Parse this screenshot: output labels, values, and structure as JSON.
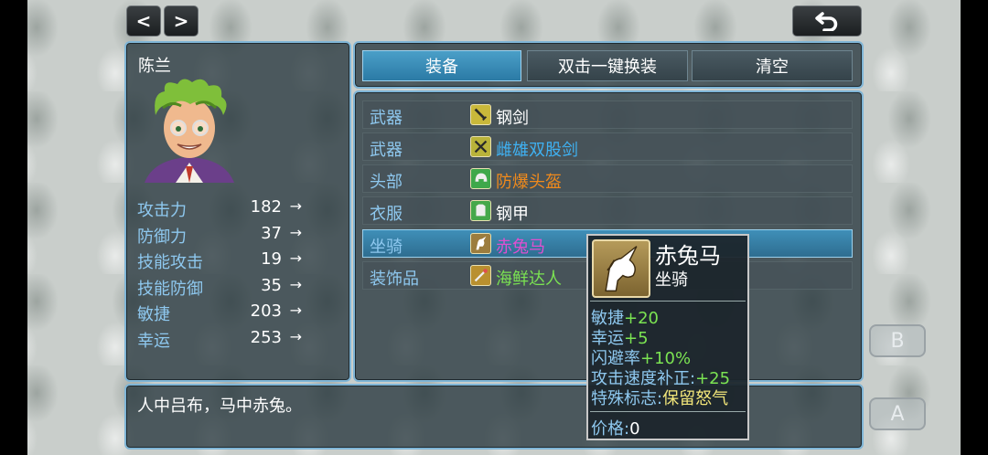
{
  "nav": {
    "prev_label": "<",
    "next_label": ">",
    "back_icon": "undo-arrow-icon"
  },
  "character": {
    "name": "陈兰",
    "stats": [
      {
        "label": "攻击力",
        "value": "182",
        "arrow": "→"
      },
      {
        "label": "防御力",
        "value": "37",
        "arrow": "→"
      },
      {
        "label": "技能攻击",
        "value": "19",
        "arrow": "→"
      },
      {
        "label": "技能防御",
        "value": "35",
        "arrow": "→"
      },
      {
        "label": "敏捷",
        "value": "203",
        "arrow": "→"
      },
      {
        "label": "幸运",
        "value": "253",
        "arrow": "→"
      }
    ]
  },
  "tabs": [
    {
      "label": "装备",
      "active": true
    },
    {
      "label": "双击一键换装",
      "active": false
    },
    {
      "label": "清空",
      "active": false
    }
  ],
  "equipment": [
    {
      "slot": "武器",
      "icon": "sword-icon",
      "name": "钢剑",
      "color": "#ffffff",
      "icon_bg": "#c9b83a"
    },
    {
      "slot": "武器",
      "icon": "crossed-swords-icon",
      "name": "雌雄双股剑",
      "color": "#3fb1f2",
      "icon_bg": "#b9b33a"
    },
    {
      "slot": "头部",
      "icon": "helmet-icon",
      "name": "防爆头盔",
      "color": "#f08a1c",
      "icon_bg": "#3fa84a"
    },
    {
      "slot": "衣服",
      "icon": "armor-icon",
      "name": "钢甲",
      "color": "#ffffff",
      "icon_bg": "#45a84a"
    },
    {
      "slot": "坐骑",
      "icon": "unicorn-icon",
      "name": "赤兔马",
      "color": "#e04fd0",
      "icon_bg": "#9c7d3e"
    },
    {
      "slot": "装饰品",
      "icon": "accessory-icon",
      "name": "海鲜达人",
      "color": "#7be352",
      "icon_bg": "#b9902f"
    }
  ],
  "tooltip": {
    "icon": "unicorn-icon",
    "title": "赤兔马",
    "subtitle": "坐骑",
    "effects": [
      {
        "label": "敏捷",
        "value": "+20",
        "value_color": "#7be352"
      },
      {
        "label": "幸运",
        "value": "+5",
        "value_color": "#7be352"
      },
      {
        "label": "闪避率",
        "value": "+10%",
        "value_color": "#7be352"
      },
      {
        "label": "攻击速度补正:",
        "value": "+25",
        "value_color": "#7be352"
      },
      {
        "label": "特殊标志:",
        "value": "保留怒气",
        "value_color": "#f2e67a"
      }
    ],
    "price_label": "价格:",
    "price_value": "0"
  },
  "message": "人中吕布，马中赤兔。",
  "buttons": {
    "b_label": "B",
    "a_label": "A"
  },
  "colors": {
    "border": "#7fb5d6",
    "label_blue": "#8ec8ef",
    "tab_active": "#2b7aa5"
  }
}
